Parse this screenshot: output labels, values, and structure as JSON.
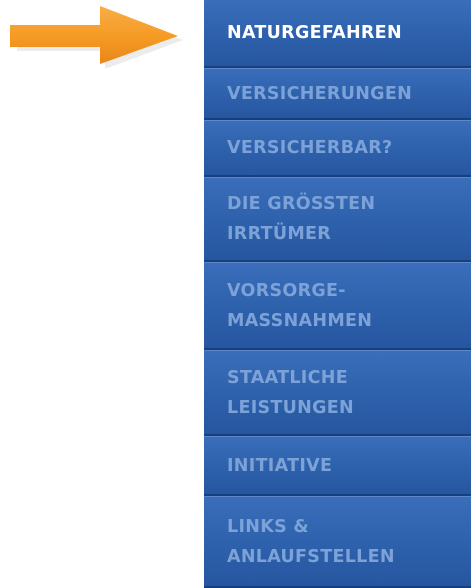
{
  "pointer": {
    "icon": "arrow-right-icon",
    "color": "#f59a23"
  },
  "nav": {
    "active_color": "#ffffff",
    "inactive_color": "#7ca2d8",
    "background": "#2f63ae",
    "items": [
      {
        "label": "NATURGEFAHREN",
        "active": true
      },
      {
        "label": "VERSICHERUNGEN",
        "active": false
      },
      {
        "label": "VERSICHERBAR?",
        "active": false
      },
      {
        "label": "DIE GRÖSSTEN\nIRRTÜMER",
        "active": false
      },
      {
        "label": "VORSORGE-\nMASSNAHMEN",
        "active": false
      },
      {
        "label": "STAATLICHE\nLEISTUNGEN",
        "active": false
      },
      {
        "label": "INITIATIVE",
        "active": false
      },
      {
        "label": "LINKS &\nANLAUFSTELLEN",
        "active": false
      }
    ]
  }
}
